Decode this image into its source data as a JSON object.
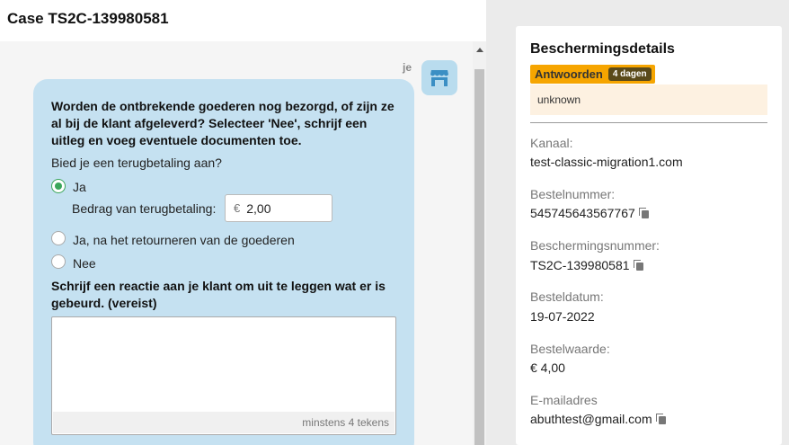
{
  "header": {
    "case_title": "Case TS2C-139980581"
  },
  "chat": {
    "sender": "je",
    "question": "Worden de ontbrekende goederen nog bezorgd, of zijn ze al bij de klant afgeleverd? Selecteer 'Nee', schrijf een uitleg en voeg eventuele documenten toe.",
    "refund_question": "Bied je een terugbetaling aan?",
    "options": [
      {
        "label": "Ja",
        "selected": true
      },
      {
        "label": "Ja, na het retourneren van de goederen",
        "selected": false
      },
      {
        "label": "Nee",
        "selected": false
      }
    ],
    "amount_label": "Bedrag van terugbetaling:",
    "amount_currency": "€",
    "amount_value": "2,00",
    "reply_prompt": "Schrijf een reactie aan je klant om uit te leggen wat er is gebeurd. (vereist)",
    "reply_value": "",
    "reply_hint": "minstens 4 tekens"
  },
  "details": {
    "title": "Beschermingsdetails",
    "status_label": "Antwoorden",
    "status_days": "4 dagen",
    "status_note": "unknown",
    "fields": [
      {
        "label": "Kanaal:",
        "value": "test-classic-migration1.com",
        "copy": false
      },
      {
        "label": "Bestelnummer:",
        "value": "545745643567767",
        "copy": true
      },
      {
        "label": "Beschermingsnummer:",
        "value": "TS2C-139980581",
        "copy": true
      },
      {
        "label": "Besteldatum:",
        "value": "19-07-2022",
        "copy": false
      },
      {
        "label": "Bestelwaarde:",
        "value": "€ 4,00",
        "copy": false
      },
      {
        "label": "E-mailadres",
        "value": "abuthtest@gmail.com",
        "copy": true
      }
    ]
  },
  "colors": {
    "bubble": "#c5e1f1",
    "radio_selected": "#3aa55a",
    "status_badge": "#f6a500",
    "status_note_bg": "#fdf1e1"
  },
  "icons": {
    "avatar": "store-icon",
    "copy": "copy-icon"
  }
}
